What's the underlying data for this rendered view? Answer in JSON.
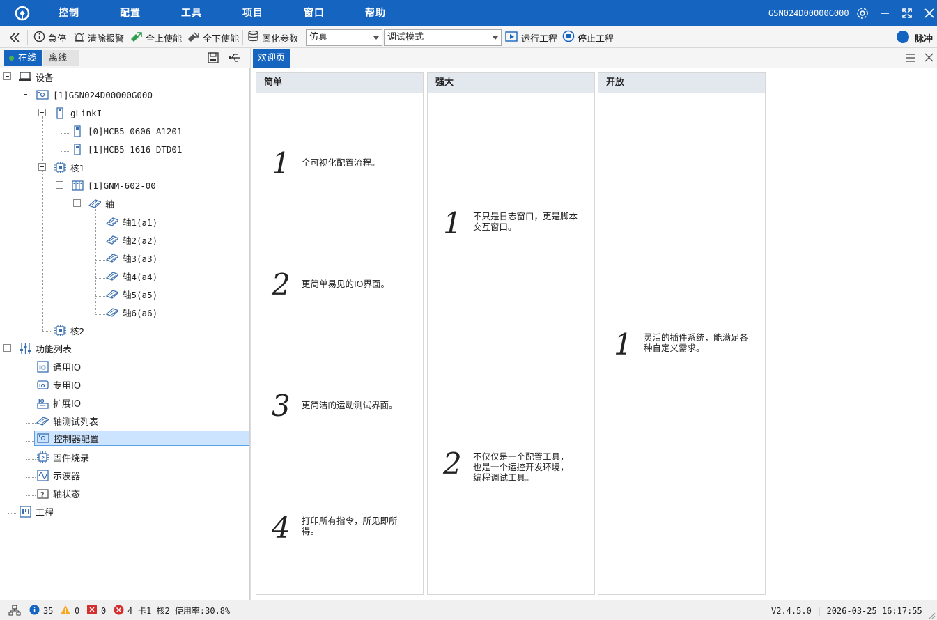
{
  "menubar": {
    "items": [
      "控制",
      "配置",
      "工具",
      "项目",
      "窗口",
      "帮助"
    ],
    "device": "GSN024D00000G000",
    "accent": "#1565c0"
  },
  "toolbar": {
    "estop": "急停",
    "clear_alarm": "清除报警",
    "enable_all": "全上使能",
    "disable_all": "全下使能",
    "solidify": "固化参数",
    "mode_select": "仿真",
    "debug_select": "调试模式",
    "run_project": "运行工程",
    "stop_project": "停止工程",
    "pulse": "脉冲"
  },
  "left_panel": {
    "tab_online": "在线",
    "tab_offline": "离线",
    "tree": {
      "device": "设备",
      "controller": "[1]GSN024D00000G000",
      "glink": "gLinkI",
      "io0": "[0]HCB5-0606-A1201",
      "io1": "[1]HCB5-1616-DTD01",
      "core1": "核1",
      "gnm": "[1]GNM-602-00",
      "axis_group": "轴",
      "axes": [
        "轴1(a1)",
        "轴2(a2)",
        "轴3(a3)",
        "轴4(a4)",
        "轴5(a5)",
        "轴6(a6)"
      ],
      "core2": "核2",
      "func_list": "功能列表",
      "funcs": [
        "通用IO",
        "专用IO",
        "扩展IO",
        "轴测试列表",
        "控制器配置",
        "固件烧录",
        "示波器",
        "轴状态"
      ],
      "project": "工程"
    }
  },
  "doc": {
    "tab": "欢迎页",
    "cards": [
      {
        "title": "简单",
        "items": [
          {
            "n": "1",
            "text": "全可视化配置流程。"
          },
          {
            "n": "2",
            "text": "更简单易见的IO界面。"
          },
          {
            "n": "3",
            "text": "更简洁的运动测试界面。"
          },
          {
            "n": "4",
            "text": "打印所有指令，所见即所得。"
          }
        ]
      },
      {
        "title": "强大",
        "items": [
          {
            "n": "1",
            "text": "不只是日志窗口，更是脚本交互窗口。"
          },
          {
            "n": "2",
            "text": "不仅仅是一个配置工具，也是一个运控开发环境，编程调试工具。"
          }
        ]
      },
      {
        "title": "开放",
        "items": [
          {
            "n": "1",
            "text": "灵活的插件系统，能满足各种自定义需求。"
          }
        ]
      }
    ]
  },
  "status": {
    "info_count": "35",
    "warn_count": "0",
    "error_count": "0",
    "fatal_count": "4",
    "card_info": "卡1 核2 使用率:30.8%",
    "version_time": "V2.4.5.0 | 2026-03-25 16:17:55"
  }
}
